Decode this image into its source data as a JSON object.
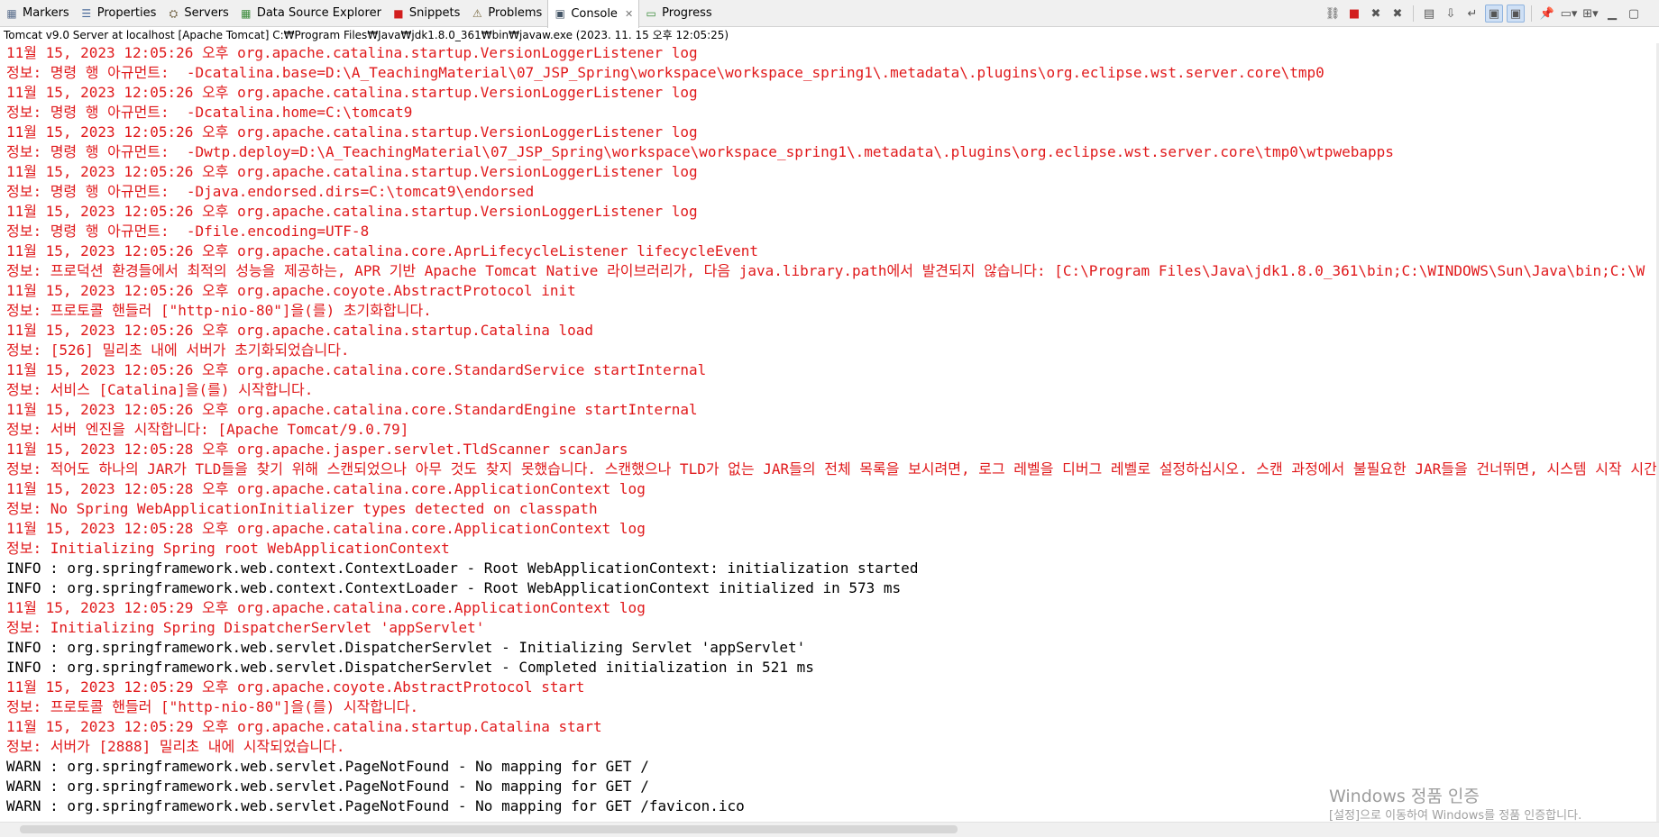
{
  "tabs": [
    {
      "label": "Markers",
      "icon": "markers-icon",
      "glyph": "▦",
      "color": "#5a6e8c"
    },
    {
      "label": "Properties",
      "icon": "properties-icon",
      "glyph": "☰",
      "color": "#4a6a9a"
    },
    {
      "label": "Servers",
      "icon": "servers-icon",
      "glyph": "⛭",
      "color": "#6b5a3a"
    },
    {
      "label": "Data Source Explorer",
      "icon": "data-source-icon",
      "glyph": "▦",
      "color": "#3a8a3a"
    },
    {
      "label": "Snippets",
      "icon": "snippets-icon",
      "glyph": "■",
      "color": "#d21e1e"
    },
    {
      "label": "Problems",
      "icon": "problems-icon",
      "glyph": "⚠",
      "color": "#7a6a40"
    },
    {
      "label": "Console",
      "icon": "console-icon",
      "glyph": "▣",
      "color": "#445566",
      "active": true,
      "close": "✕"
    },
    {
      "label": "Progress",
      "icon": "progress-icon",
      "glyph": "▭",
      "color": "#3a8a3a"
    }
  ],
  "toolbar": [
    {
      "name": "link-icon",
      "glyph": "⛓"
    },
    {
      "name": "terminate-icon",
      "glyph": "■",
      "red": true
    },
    {
      "name": "remove-launch-icon",
      "glyph": "✖"
    },
    {
      "name": "remove-all-icon",
      "glyph": "✖"
    },
    {
      "sep": true
    },
    {
      "name": "clear-console-icon",
      "glyph": "▤"
    },
    {
      "name": "scroll-lock-icon",
      "glyph": "⇩"
    },
    {
      "name": "word-wrap-icon",
      "glyph": "↵"
    },
    {
      "name": "show-stdout-icon",
      "glyph": "▣",
      "selected": true
    },
    {
      "name": "show-stderr-icon",
      "glyph": "▣",
      "selected": true
    },
    {
      "sep": true
    },
    {
      "name": "pin-console-icon",
      "glyph": "📌"
    },
    {
      "name": "display-console-icon",
      "glyph": "▭▾"
    },
    {
      "name": "open-console-icon",
      "glyph": "⊞▾"
    },
    {
      "name": "minimize-icon",
      "glyph": "▁"
    },
    {
      "name": "maximize-icon",
      "glyph": "▢"
    }
  ],
  "process_description": "Tomcat v9.0 Server at localhost [Apache Tomcat] C:₩Program Files₩Java₩jdk1.8.0_361₩bin₩javaw.exe  (2023. 11. 15 오후 12:05:25)",
  "console_colors": {
    "stderr": "#e0191b",
    "stdout": "#000000"
  },
  "console_lines": [
    {
      "text": "11월 15, 2023 12:05:26 오후 org.apache.catalina.startup.VersionLoggerListener log",
      "stream": "err"
    },
    {
      "text": "정보: 명령 행 아규먼트:  -Dcatalina.base=D:\\A_TeachingMaterial\\07_JSP_Spring\\workspace\\workspace_spring1\\.metadata\\.plugins\\org.eclipse.wst.server.core\\tmp0",
      "stream": "err"
    },
    {
      "text": "11월 15, 2023 12:05:26 오후 org.apache.catalina.startup.VersionLoggerListener log",
      "stream": "err"
    },
    {
      "text": "정보: 명령 행 아규먼트:  -Dcatalina.home=C:\\tomcat9",
      "stream": "err"
    },
    {
      "text": "11월 15, 2023 12:05:26 오후 org.apache.catalina.startup.VersionLoggerListener log",
      "stream": "err"
    },
    {
      "text": "정보: 명령 행 아규먼트:  -Dwtp.deploy=D:\\A_TeachingMaterial\\07_JSP_Spring\\workspace\\workspace_spring1\\.metadata\\.plugins\\org.eclipse.wst.server.core\\tmp0\\wtpwebapps",
      "stream": "err"
    },
    {
      "text": "11월 15, 2023 12:05:26 오후 org.apache.catalina.startup.VersionLoggerListener log",
      "stream": "err"
    },
    {
      "text": "정보: 명령 행 아규먼트:  -Djava.endorsed.dirs=C:\\tomcat9\\endorsed",
      "stream": "err"
    },
    {
      "text": "11월 15, 2023 12:05:26 오후 org.apache.catalina.startup.VersionLoggerListener log",
      "stream": "err"
    },
    {
      "text": "정보: 명령 행 아규먼트:  -Dfile.encoding=UTF-8",
      "stream": "err"
    },
    {
      "text": "11월 15, 2023 12:05:26 오후 org.apache.catalina.core.AprLifecycleListener lifecycleEvent",
      "stream": "err"
    },
    {
      "text": "정보: 프로덕션 환경들에서 최적의 성능을 제공하는, APR 기반 Apache Tomcat Native 라이브러리가, 다음 java.library.path에서 발견되지 않습니다: [C:\\Program Files\\Java\\jdk1.8.0_361\\bin;C:\\WINDOWS\\Sun\\Java\\bin;C:\\W",
      "stream": "err"
    },
    {
      "text": "11월 15, 2023 12:05:26 오후 org.apache.coyote.AbstractProtocol init",
      "stream": "err"
    },
    {
      "text": "정보: 프로토콜 핸들러 [\"http-nio-80\"]을(를) 초기화합니다.",
      "stream": "err"
    },
    {
      "text": "11월 15, 2023 12:05:26 오후 org.apache.catalina.startup.Catalina load",
      "stream": "err"
    },
    {
      "text": "정보: [526] 밀리초 내에 서버가 초기화되었습니다.",
      "stream": "err"
    },
    {
      "text": "11월 15, 2023 12:05:26 오후 org.apache.catalina.core.StandardService startInternal",
      "stream": "err"
    },
    {
      "text": "정보: 서비스 [Catalina]을(를) 시작합니다.",
      "stream": "err"
    },
    {
      "text": "11월 15, 2023 12:05:26 오후 org.apache.catalina.core.StandardEngine startInternal",
      "stream": "err"
    },
    {
      "text": "정보: 서버 엔진을 시작합니다: [Apache Tomcat/9.0.79]",
      "stream": "err"
    },
    {
      "text": "11월 15, 2023 12:05:28 오후 org.apache.jasper.servlet.TldScanner scanJars",
      "stream": "err"
    },
    {
      "text": "정보: 적어도 하나의 JAR가 TLD들을 찾기 위해 스캔되었으나 아무 것도 찾지 못했습니다. 스캔했으나 TLD가 없는 JAR들의 전체 목록을 보시려면, 로그 레벨을 디버그 레벨로 설정하십시오. 스캔 과정에서 불필요한 JAR들을 건너뛰면, 시스템 시작 시간과 JSP 컴파",
      "stream": "err"
    },
    {
      "text": "11월 15, 2023 12:05:28 오후 org.apache.catalina.core.ApplicationContext log",
      "stream": "err"
    },
    {
      "text": "정보: No Spring WebApplicationInitializer types detected on classpath",
      "stream": "err"
    },
    {
      "text": "11월 15, 2023 12:05:28 오후 org.apache.catalina.core.ApplicationContext log",
      "stream": "err"
    },
    {
      "text": "정보: Initializing Spring root WebApplicationContext",
      "stream": "err"
    },
    {
      "text": "INFO : org.springframework.web.context.ContextLoader - Root WebApplicationContext: initialization started",
      "stream": "out"
    },
    {
      "text": "INFO : org.springframework.web.context.ContextLoader - Root WebApplicationContext initialized in 573 ms",
      "stream": "out"
    },
    {
      "text": "11월 15, 2023 12:05:29 오후 org.apache.catalina.core.ApplicationContext log",
      "stream": "err"
    },
    {
      "text": "정보: Initializing Spring DispatcherServlet 'appServlet'",
      "stream": "err"
    },
    {
      "text": "INFO : org.springframework.web.servlet.DispatcherServlet - Initializing Servlet 'appServlet'",
      "stream": "out"
    },
    {
      "text": "INFO : org.springframework.web.servlet.DispatcherServlet - Completed initialization in 521 ms",
      "stream": "out"
    },
    {
      "text": "11월 15, 2023 12:05:29 오후 org.apache.coyote.AbstractProtocol start",
      "stream": "err"
    },
    {
      "text": "정보: 프로토콜 핸들러 [\"http-nio-80\"]을(를) 시작합니다.",
      "stream": "err"
    },
    {
      "text": "11월 15, 2023 12:05:29 오후 org.apache.catalina.startup.Catalina start",
      "stream": "err"
    },
    {
      "text": "정보: 서버가 [2888] 밀리초 내에 시작되었습니다.",
      "stream": "err"
    },
    {
      "text": "WARN : org.springframework.web.servlet.PageNotFound - No mapping for GET /",
      "stream": "out"
    },
    {
      "text": "WARN : org.springframework.web.servlet.PageNotFound - No mapping for GET /",
      "stream": "out"
    },
    {
      "text": "WARN : org.springframework.web.servlet.PageNotFound - No mapping for GET /favicon.ico",
      "stream": "out"
    }
  ],
  "watermark": {
    "title": "Windows 정품 인증",
    "subtitle": "[설정]으로 이동하여 Windows를 정품 인증합니다."
  }
}
